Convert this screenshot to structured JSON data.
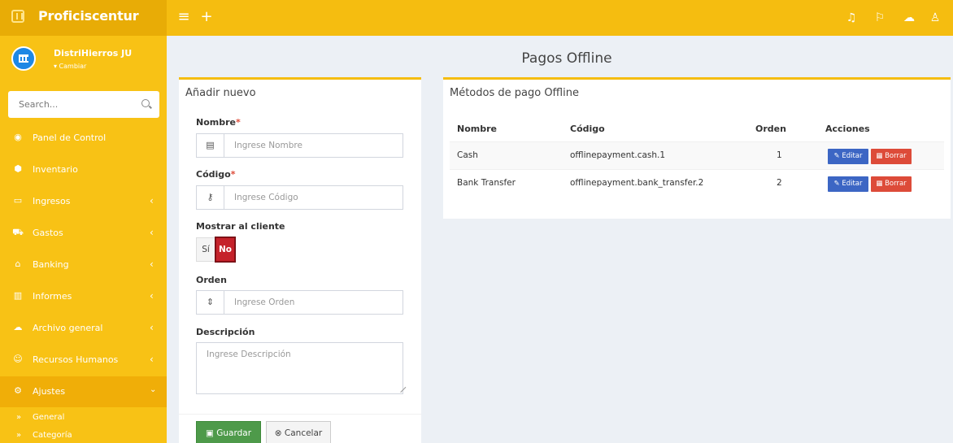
{
  "app": {
    "brand": "Proficiscentur"
  },
  "topbar": {
    "menu_icon": "bars-icon",
    "add_icon": "plus-icon",
    "right_icons": [
      "bell-icon",
      "flag-icon",
      "comments-icon",
      "user-icon"
    ],
    "color": "#f5bd10"
  },
  "user": {
    "name": "DistriHierros JU",
    "change": "▾ Cambiar"
  },
  "search": {
    "placeholder": "Search..."
  },
  "sidebar": {
    "items": [
      {
        "label": "Panel de Control",
        "icon": "dashboard-icon"
      },
      {
        "label": "Inventario",
        "icon": "cubes-icon"
      },
      {
        "label": "Ingresos",
        "icon": "money-icon"
      },
      {
        "label": "Gastos",
        "icon": "cart-icon"
      },
      {
        "label": "Banking",
        "icon": "bank-icon"
      },
      {
        "label": "Informes",
        "icon": "chart-icon"
      },
      {
        "label": "Archivo general",
        "icon": "cloud-icon"
      },
      {
        "label": "Recursos Humanos",
        "icon": "users-icon"
      },
      {
        "label": "Ajustes",
        "icon": "cogs-icon"
      }
    ],
    "subitems": [
      {
        "label": "General"
      },
      {
        "label": "Categoría"
      }
    ]
  },
  "page": {
    "title": "Pagos Offline"
  },
  "form": {
    "title": "Añadir nuevo",
    "name_label": "Nombre",
    "name_placeholder": "Ingrese Nombre",
    "code_label": "Código",
    "code_placeholder": "Ingrese Código",
    "required_mark": "*",
    "show_label": "Mostrar al cliente",
    "show_yes": "Sí",
    "show_no": "No",
    "order_label": "Orden",
    "order_placeholder": "Ingrese Orden",
    "desc_label": "Descripción",
    "desc_placeholder": "Ingrese Descripción",
    "save": "Guardar",
    "cancel": "Cancelar"
  },
  "table": {
    "title": "Métodos de pago Offline",
    "headers": {
      "name": "Nombre",
      "code": "Código",
      "order": "Orden",
      "actions": "Acciones"
    },
    "rows": [
      {
        "name": "Cash",
        "code": "offlinepayment.cash.1",
        "order": "1"
      },
      {
        "name": "Bank Transfer",
        "code": "offlinepayment.bank_transfer.2",
        "order": "2"
      }
    ],
    "edit": "Editar",
    "delete": "Borrar"
  }
}
